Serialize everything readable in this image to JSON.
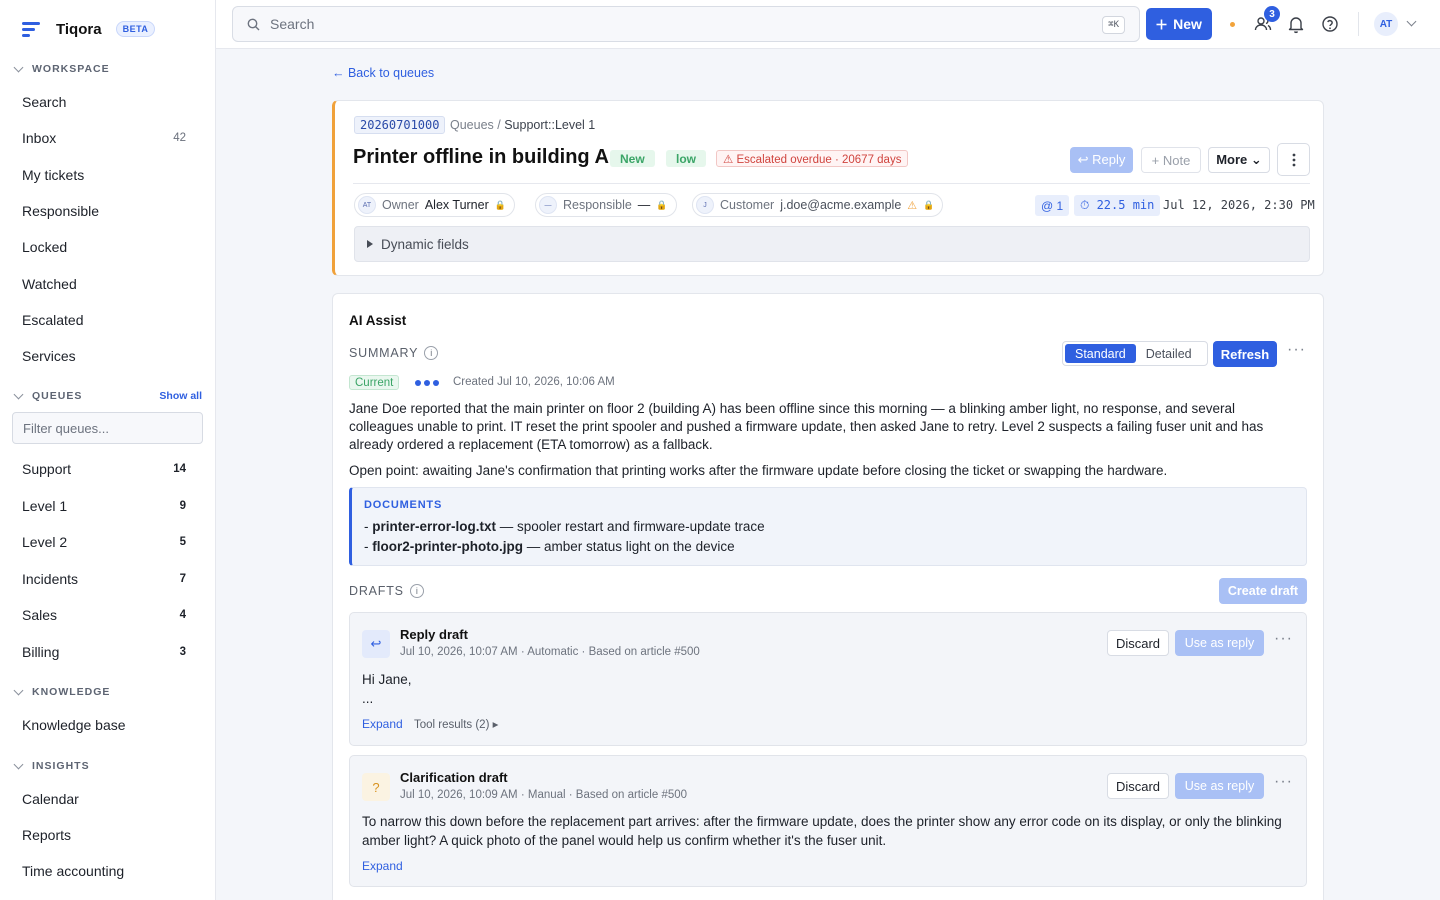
{
  "app": {
    "name": "Tiqora",
    "badge": "BETA"
  },
  "sidebar": {
    "workspace": {
      "heading": "WORKSPACE",
      "items": [
        {
          "label": "Search",
          "count": ""
        },
        {
          "label": "Inbox",
          "count": "42"
        },
        {
          "label": "My tickets",
          "count": ""
        },
        {
          "label": "Responsible",
          "count": ""
        },
        {
          "label": "Locked",
          "count": ""
        },
        {
          "label": "Watched",
          "count": ""
        },
        {
          "label": "Escalated",
          "count": ""
        },
        {
          "label": "Services",
          "count": ""
        }
      ]
    },
    "queues": {
      "heading": "QUEUES",
      "show_all": "Show all",
      "filter_placeholder": "Filter queues...",
      "items": [
        {
          "label": "Support",
          "count": "14"
        },
        {
          "label": "Level 1",
          "count": "9"
        },
        {
          "label": "Level 2",
          "count": "5"
        },
        {
          "label": "Incidents",
          "count": "7"
        },
        {
          "label": "Sales",
          "count": "4"
        },
        {
          "label": "Billing",
          "count": "3"
        }
      ]
    },
    "knowledge": {
      "heading": "KNOWLEDGE",
      "items": [
        {
          "label": "Knowledge base"
        }
      ]
    },
    "insights": {
      "heading": "INSIGHTS",
      "items": [
        {
          "label": "Calendar"
        },
        {
          "label": "Reports"
        },
        {
          "label": "Time accounting"
        }
      ]
    }
  },
  "topbar": {
    "search_placeholder": "Search",
    "shortcut": "⌘K",
    "new_label": "New",
    "notification_count": "3",
    "avatar_initials": "AT"
  },
  "ticket": {
    "back_label": "← Back to queues",
    "number": "20260701000",
    "breadcrumb_root": "Queues /",
    "breadcrumb_queue": "Support::Level 1",
    "title": "Printer offline in building A",
    "state": "New",
    "priority": "low",
    "escalation": "⚠ Escalated overdue · 20677 days",
    "actions": {
      "reply": "↩ Reply",
      "note": "+ Note",
      "more": "More ⌄"
    },
    "owner": {
      "initials": "AT",
      "label": "Owner",
      "value": "Alex Turner"
    },
    "responsible": {
      "initials": "—",
      "label": "Responsible",
      "value": "—"
    },
    "customer": {
      "initials": "J",
      "label": "Customer",
      "value": "j.doe@acme.example"
    },
    "article_count": "@ 1",
    "time": "⏱ 22.5 min",
    "date": "Jul 12, 2026, 2:30 PM",
    "dynamic_fields": "Dynamic fields"
  },
  "ai": {
    "title": "AI Assist",
    "summary_label": "SUMMARY",
    "mode_standard": "Standard",
    "mode_detailed": "Detailed",
    "refresh": "Refresh",
    "current": "Current",
    "created": "Created Jul 10, 2026, 10:06 AM",
    "summary_text": "Jane Doe reported that the main printer on floor 2 (building A) has been offline since this morning — a blinking amber light, no response, and several colleagues unable to print. IT reset the print spooler and pushed a firmware update, then asked Jane to retry. Level 2 suspects a failing fuser unit and has already ordered a replacement (ETA tomorrow) as a fallback.",
    "open_point": "Open point: awaiting Jane's confirmation that printing works after the firmware update before closing the ticket or swapping the hardware.",
    "documents_heading": "DOCUMENTS",
    "documents": [
      {
        "name": "printer-error-log.txt",
        "desc": " — spooler restart and firmware-update trace"
      },
      {
        "name": "floor2-printer-photo.jpg",
        "desc": " — amber status light on the device"
      }
    ],
    "drafts_label": "DRAFTS",
    "create_draft": "Create draft",
    "drafts": [
      {
        "title": "Reply draft",
        "meta": "Jul 10, 2026, 10:07 AM · Automatic · Based on article #500",
        "body_line1": "Hi Jane,",
        "body_line2": "...",
        "expand": "Expand",
        "tool_results": "Tool results (2) ▸",
        "discard": "Discard",
        "use": "Use as reply"
      },
      {
        "title": "Clarification draft",
        "meta": "Jul 10, 2026, 10:09 AM · Manual · Based on article #500",
        "body": "To narrow this down before the replacement part arrives: after the firmware update, does the printer show any error code on its display, or only the blinking amber light? A quick photo of the panel would help us confirm whether it's the fuser unit.",
        "expand": "Expand",
        "discard": "Discard",
        "use": "Use as reply"
      }
    ]
  },
  "colors": {
    "accent": "#2f5fe0",
    "escalation_border": "#f0a13a",
    "success": "#3ba567",
    "danger": "#d0443e"
  }
}
